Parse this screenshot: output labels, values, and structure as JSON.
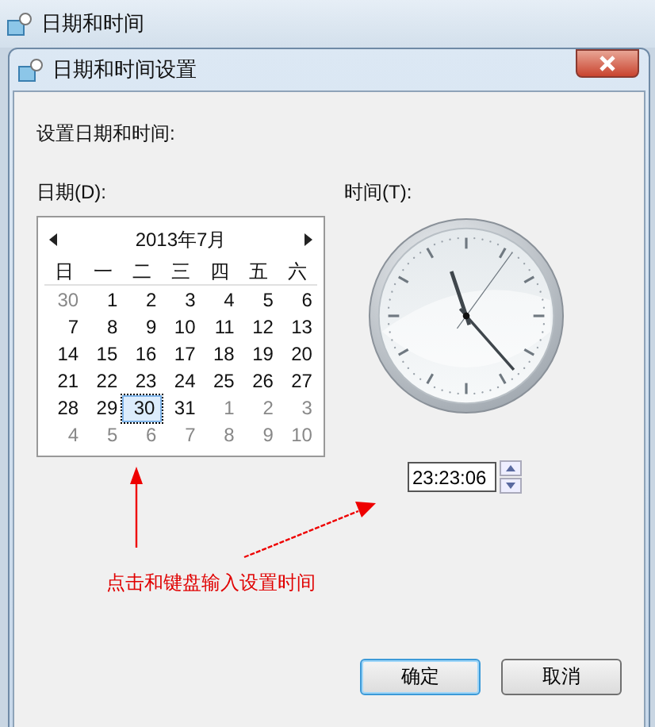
{
  "background_window": {
    "title": "日期和时间"
  },
  "dialog": {
    "title": "日期和时间设置",
    "heading": "设置日期和时间:"
  },
  "date": {
    "label": "日期(D):",
    "month": "2013年7月",
    "weekdays": [
      "日",
      "一",
      "二",
      "三",
      "四",
      "五",
      "六"
    ],
    "days": [
      {
        "day": "30",
        "in_month": false,
        "selected": false
      },
      {
        "day": "1",
        "in_month": true,
        "selected": false
      },
      {
        "day": "2",
        "in_month": true,
        "selected": false
      },
      {
        "day": "3",
        "in_month": true,
        "selected": false
      },
      {
        "day": "4",
        "in_month": true,
        "selected": false
      },
      {
        "day": "5",
        "in_month": true,
        "selected": false
      },
      {
        "day": "6",
        "in_month": true,
        "selected": false
      },
      {
        "day": "7",
        "in_month": true,
        "selected": false
      },
      {
        "day": "8",
        "in_month": true,
        "selected": false
      },
      {
        "day": "9",
        "in_month": true,
        "selected": false
      },
      {
        "day": "10",
        "in_month": true,
        "selected": false
      },
      {
        "day": "11",
        "in_month": true,
        "selected": false
      },
      {
        "day": "12",
        "in_month": true,
        "selected": false
      },
      {
        "day": "13",
        "in_month": true,
        "selected": false
      },
      {
        "day": "14",
        "in_month": true,
        "selected": false
      },
      {
        "day": "15",
        "in_month": true,
        "selected": false
      },
      {
        "day": "16",
        "in_month": true,
        "selected": false
      },
      {
        "day": "17",
        "in_month": true,
        "selected": false
      },
      {
        "day": "18",
        "in_month": true,
        "selected": false
      },
      {
        "day": "19",
        "in_month": true,
        "selected": false
      },
      {
        "day": "20",
        "in_month": true,
        "selected": false
      },
      {
        "day": "21",
        "in_month": true,
        "selected": false
      },
      {
        "day": "22",
        "in_month": true,
        "selected": false
      },
      {
        "day": "23",
        "in_month": true,
        "selected": false
      },
      {
        "day": "24",
        "in_month": true,
        "selected": false
      },
      {
        "day": "25",
        "in_month": true,
        "selected": false
      },
      {
        "day": "26",
        "in_month": true,
        "selected": false
      },
      {
        "day": "27",
        "in_month": true,
        "selected": false
      },
      {
        "day": "28",
        "in_month": true,
        "selected": false
      },
      {
        "day": "29",
        "in_month": true,
        "selected": false
      },
      {
        "day": "30",
        "in_month": true,
        "selected": true
      },
      {
        "day": "31",
        "in_month": true,
        "selected": false
      },
      {
        "day": "1",
        "in_month": false,
        "selected": false
      },
      {
        "day": "2",
        "in_month": false,
        "selected": false
      },
      {
        "day": "3",
        "in_month": false,
        "selected": false
      },
      {
        "day": "4",
        "in_month": false,
        "selected": false
      },
      {
        "day": "5",
        "in_month": false,
        "selected": false
      },
      {
        "day": "6",
        "in_month": false,
        "selected": false
      },
      {
        "day": "7",
        "in_month": false,
        "selected": false
      },
      {
        "day": "8",
        "in_month": false,
        "selected": false
      },
      {
        "day": "9",
        "in_month": false,
        "selected": false
      },
      {
        "day": "10",
        "in_month": false,
        "selected": false
      }
    ]
  },
  "time": {
    "label": "时间(T):",
    "value": "23:23:06"
  },
  "annotation": {
    "text": "点击和键盘输入设置时间"
  },
  "buttons": [
    {
      "label": "确定",
      "default": true
    },
    {
      "label": "取消",
      "default": false
    }
  ]
}
